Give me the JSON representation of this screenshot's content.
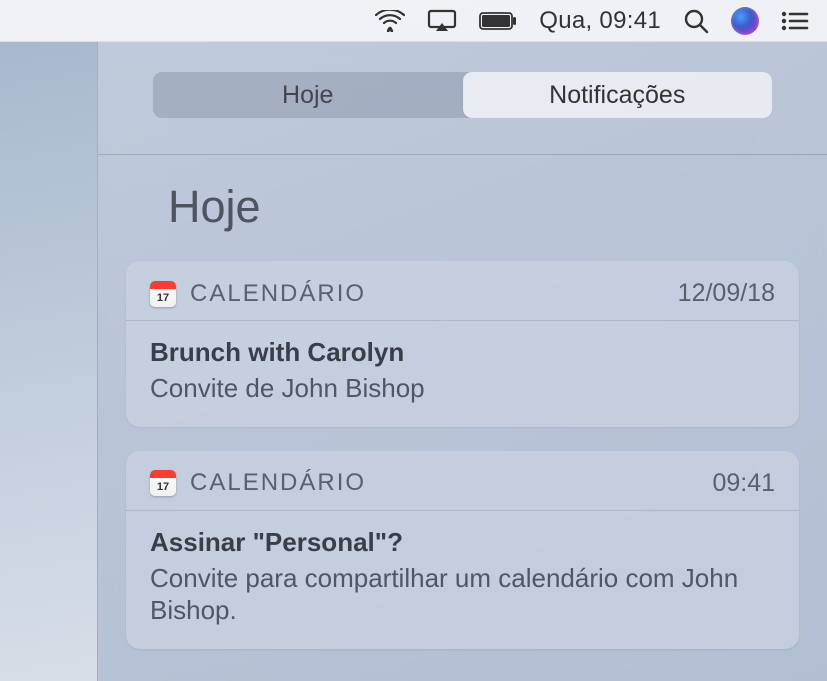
{
  "menubar": {
    "clock": "Qua, 09:41"
  },
  "tabs": {
    "today": "Hoje",
    "notifications": "Notificações"
  },
  "section": {
    "title": "Hoje"
  },
  "notifications": [
    {
      "app": "CALENDÁRIO",
      "timestamp": "12/09/18",
      "title": "Brunch with Carolyn",
      "body": "Convite de John Bishop"
    },
    {
      "app": "CALENDÁRIO",
      "timestamp": "09:41",
      "title": "Assinar \"Personal\"?",
      "body": "Convite para compartilhar um calendário com John Bishop."
    }
  ]
}
